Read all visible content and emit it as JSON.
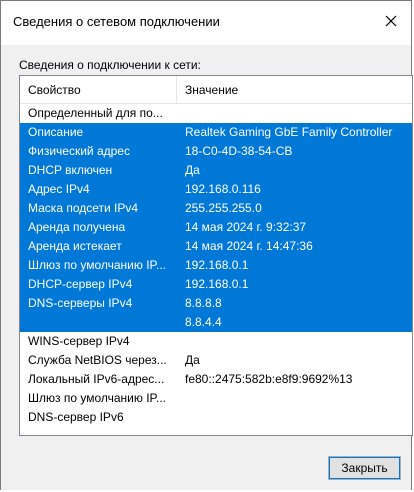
{
  "window": {
    "title": "Сведения о сетевом подключении",
    "group_label": "Сведения о подключении к сети:",
    "close_button_label": "Закрыть"
  },
  "columns": {
    "property": "Свойство",
    "value": "Значение"
  },
  "rows": [
    {
      "property": "Определенный для по...",
      "value": "",
      "selected": false
    },
    {
      "property": "Описание",
      "value": "Realtek Gaming GbE Family Controller",
      "selected": true
    },
    {
      "property": "Физический адрес",
      "value": "18-C0-4D-38-54-CB",
      "selected": true
    },
    {
      "property": "DHCP включен",
      "value": "Да",
      "selected": true
    },
    {
      "property": "Адрес IPv4",
      "value": "192.168.0.116",
      "selected": true
    },
    {
      "property": "Маска подсети IPv4",
      "value": "255.255.255.0",
      "selected": true
    },
    {
      "property": "Аренда получена",
      "value": "14 мая 2024 г. 9:32:37",
      "selected": true
    },
    {
      "property": "Аренда истекает",
      "value": "14 мая 2024 г. 14:47:36",
      "selected": true
    },
    {
      "property": "Шлюз по умолчанию IP...",
      "value": "192.168.0.1",
      "selected": true
    },
    {
      "property": "DHCP-сервер IPv4",
      "value": "192.168.0.1",
      "selected": true
    },
    {
      "property": "DNS-серверы IPv4",
      "value": "8.8.8.8",
      "selected": true
    },
    {
      "property": "",
      "value": "8.8.4.4",
      "selected": true
    },
    {
      "property": "WINS-сервер IPv4",
      "value": "",
      "selected": false
    },
    {
      "property": "Служба NetBIOS через...",
      "value": "Да",
      "selected": false
    },
    {
      "property": "Локальный IPv6-адрес...",
      "value": "fe80::2475:582b:e8f9:9692%13",
      "selected": false
    },
    {
      "property": "Шлюз по умолчанию IP...",
      "value": "",
      "selected": false
    },
    {
      "property": "DNS-сервер IPv6",
      "value": "",
      "selected": false
    }
  ],
  "colors": {
    "selection": "#0078d7",
    "selection_text": "#ffffff"
  },
  "icons": {
    "close": "close-icon"
  }
}
